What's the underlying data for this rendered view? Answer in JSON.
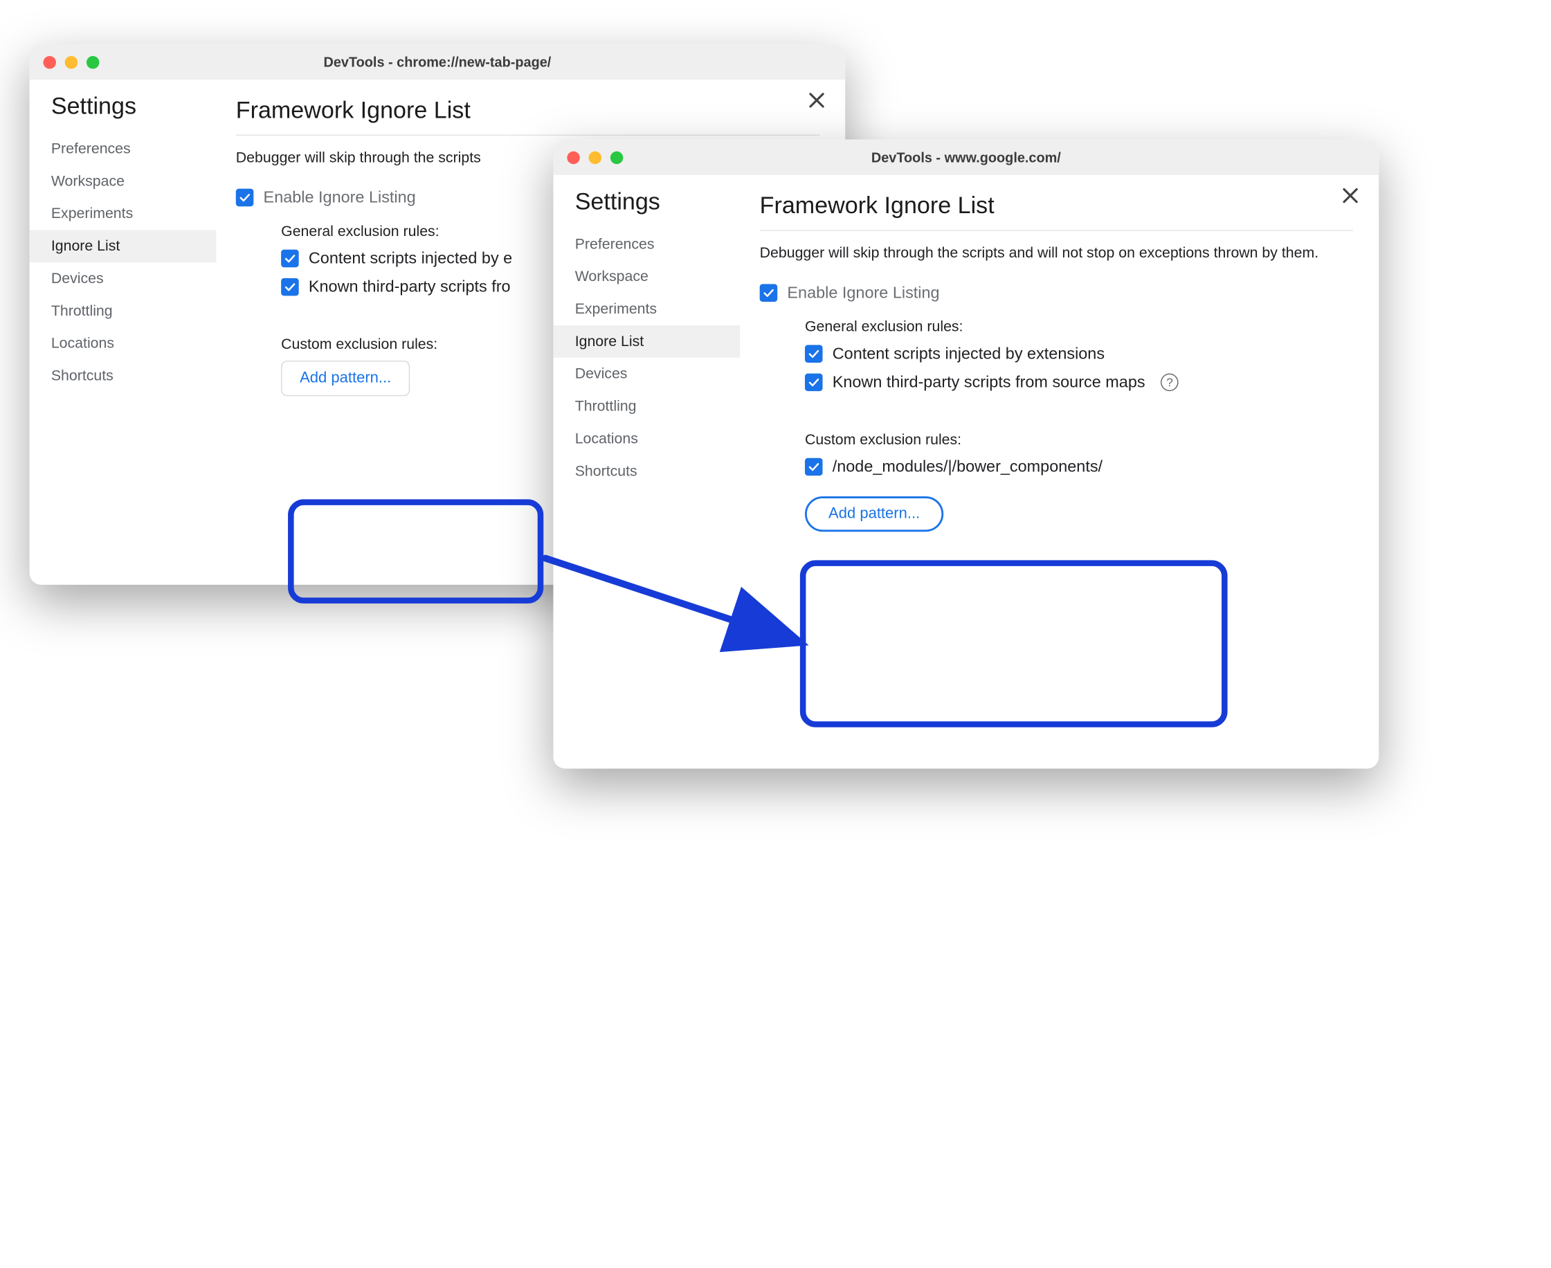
{
  "windowA": {
    "title": "DevTools - chrome://new-tab-page/",
    "sidebar_title": "Settings",
    "heading": "Framework Ignore List",
    "description": "Debugger will skip through the scripts and will not stop on exceptions thrown by them.",
    "descriptionTruncated": "Debugger will skip through the scripts                                                     thrown by them.",
    "enable_label": "Enable Ignore Listing",
    "general_rules": "General exclusion rules:",
    "rule1": "Content scripts injected by e",
    "rule2": "Known third-party scripts fro",
    "custom_rules": "Custom exclusion rules:",
    "add_pattern": "Add pattern..."
  },
  "windowB": {
    "title": "DevTools - www.google.com/",
    "sidebar_title": "Settings",
    "heading": "Framework Ignore List",
    "description": "Debugger will skip through the scripts and will not stop on exceptions thrown by them.",
    "enable_label": "Enable Ignore Listing",
    "general_rules": "General exclusion rules:",
    "rule1": "Content scripts injected by extensions",
    "rule2": "Known third-party scripts from source maps",
    "custom_rules": "Custom exclusion rules:",
    "pattern1": "/node_modules/|/bower_components/",
    "add_pattern": "Add pattern..."
  },
  "sidebar": {
    "items": [
      "Preferences",
      "Workspace",
      "Experiments",
      "Ignore List",
      "Devices",
      "Throttling",
      "Locations",
      "Shortcuts"
    ],
    "active_index": 3
  },
  "help_glyph": "?"
}
